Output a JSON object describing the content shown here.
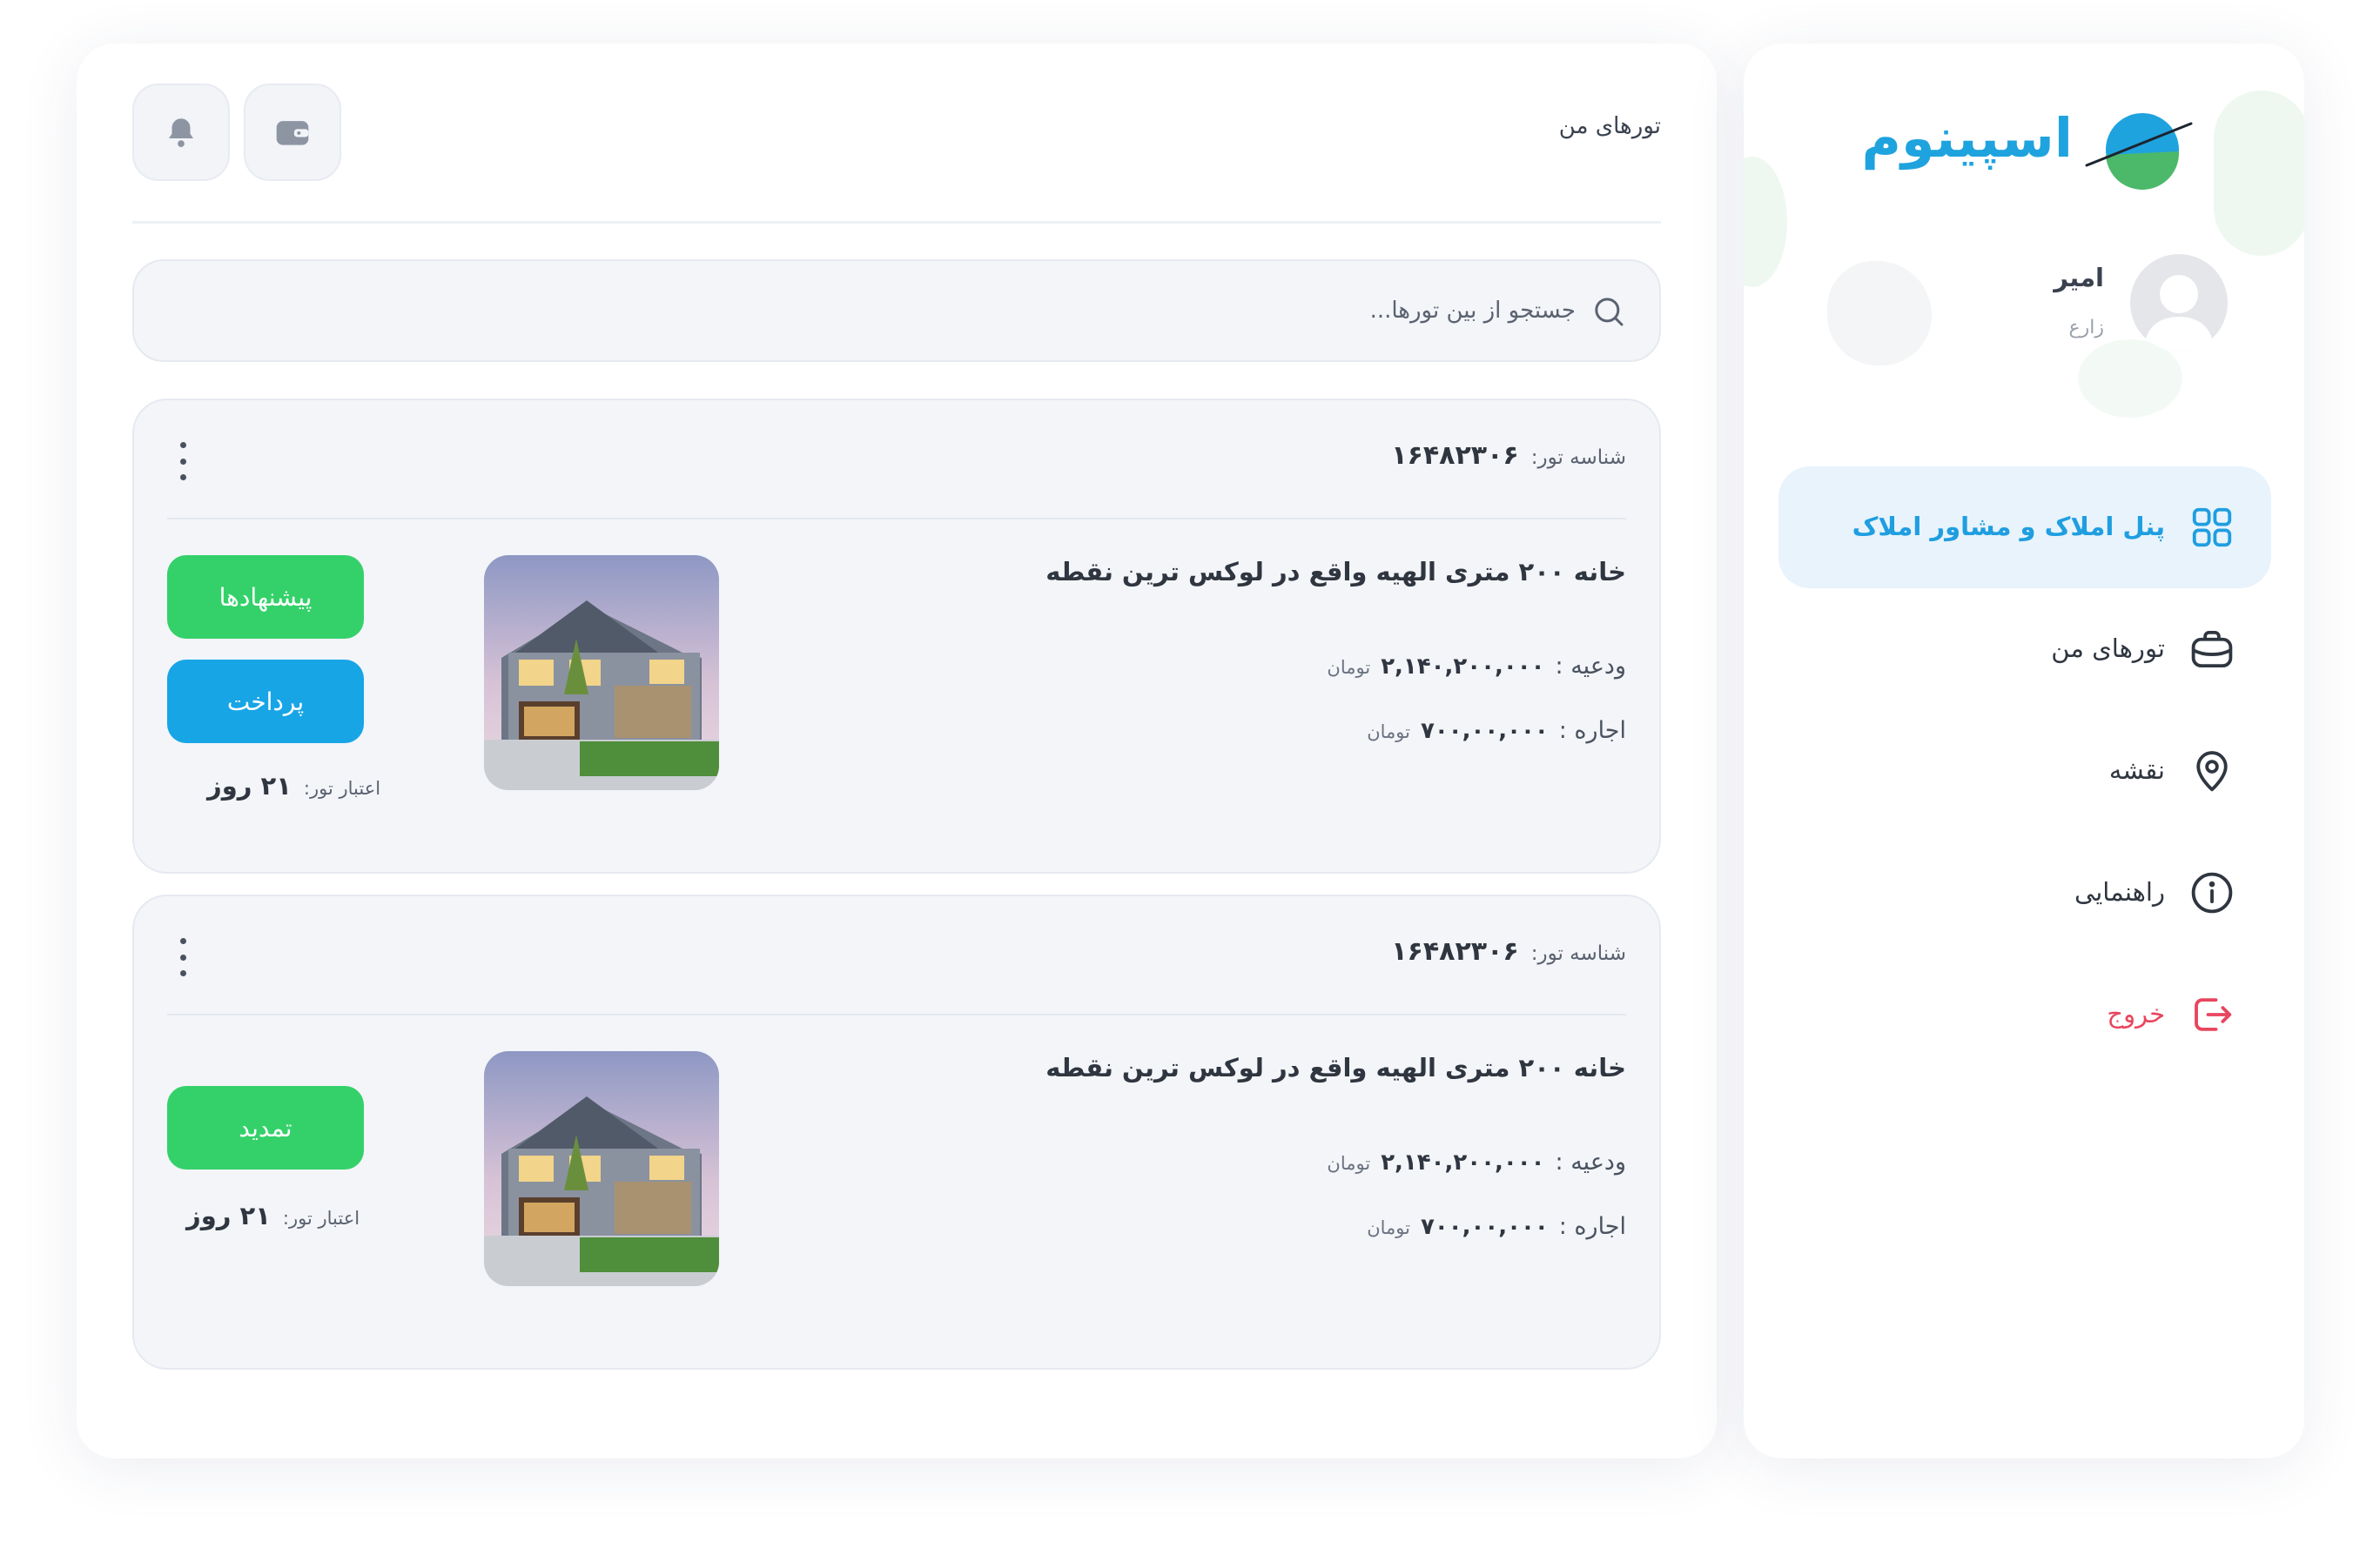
{
  "header": {
    "title": "تورهای من"
  },
  "search": {
    "placeholder": "جستجو از بین تورها..."
  },
  "tours": [
    {
      "id_label": "شناسه تور:",
      "id_value": "۱۶۴۸۲۳۰۶",
      "title": "خانه ۲۰۰ متری الهیه واقع در لوکس ترین نقطه",
      "deposit_label": "ودعیه :",
      "deposit_value": "۲,۱۴۰,۲۰۰,۰۰۰",
      "deposit_unit": "تومان",
      "rent_label": "اجاره :",
      "rent_value": "۷۰۰,۰۰,۰۰۰",
      "rent_unit": "تومان",
      "buttons": [
        "پیشنهادها",
        "پرداخت"
      ],
      "validity_label": "اعتبار تور:",
      "validity_value": "۲۱ روز"
    },
    {
      "id_label": "شناسه تور:",
      "id_value": "۱۶۴۸۲۳۰۶",
      "title": "خانه ۲۰۰ متری الهیه واقع در لوکس ترین نقطه",
      "deposit_label": "ودعیه :",
      "deposit_value": "۲,۱۴۰,۲۰۰,۰۰۰",
      "deposit_unit": "تومان",
      "rent_label": "اجاره :",
      "rent_value": "۷۰۰,۰۰,۰۰۰",
      "rent_unit": "تومان",
      "buttons": [
        "تمدید"
      ],
      "validity_label": "اعتبار تور:",
      "validity_value": "۲۱ روز"
    }
  ],
  "sidebar": {
    "logo_text": "اسپینوم",
    "user": {
      "name": "امیر",
      "role": "زارع"
    },
    "nav": [
      {
        "label": "پنل املاک و مشاور املاک",
        "icon": "grid-icon",
        "active": true
      },
      {
        "label": "تورهای من",
        "icon": "briefcase-icon",
        "active": false
      },
      {
        "label": "نقشه",
        "icon": "map-pin-icon",
        "active": false
      },
      {
        "label": "راهنمایی",
        "icon": "info-icon",
        "active": false
      },
      {
        "label": "خروج",
        "icon": "logout-icon",
        "active": false
      }
    ]
  },
  "colors": {
    "accent_blue": "#1f9ee0",
    "green": "#34d16a",
    "pay_blue": "#17a5e6",
    "logout_red": "#e8455e",
    "active_bg": "#e8f3fc"
  }
}
